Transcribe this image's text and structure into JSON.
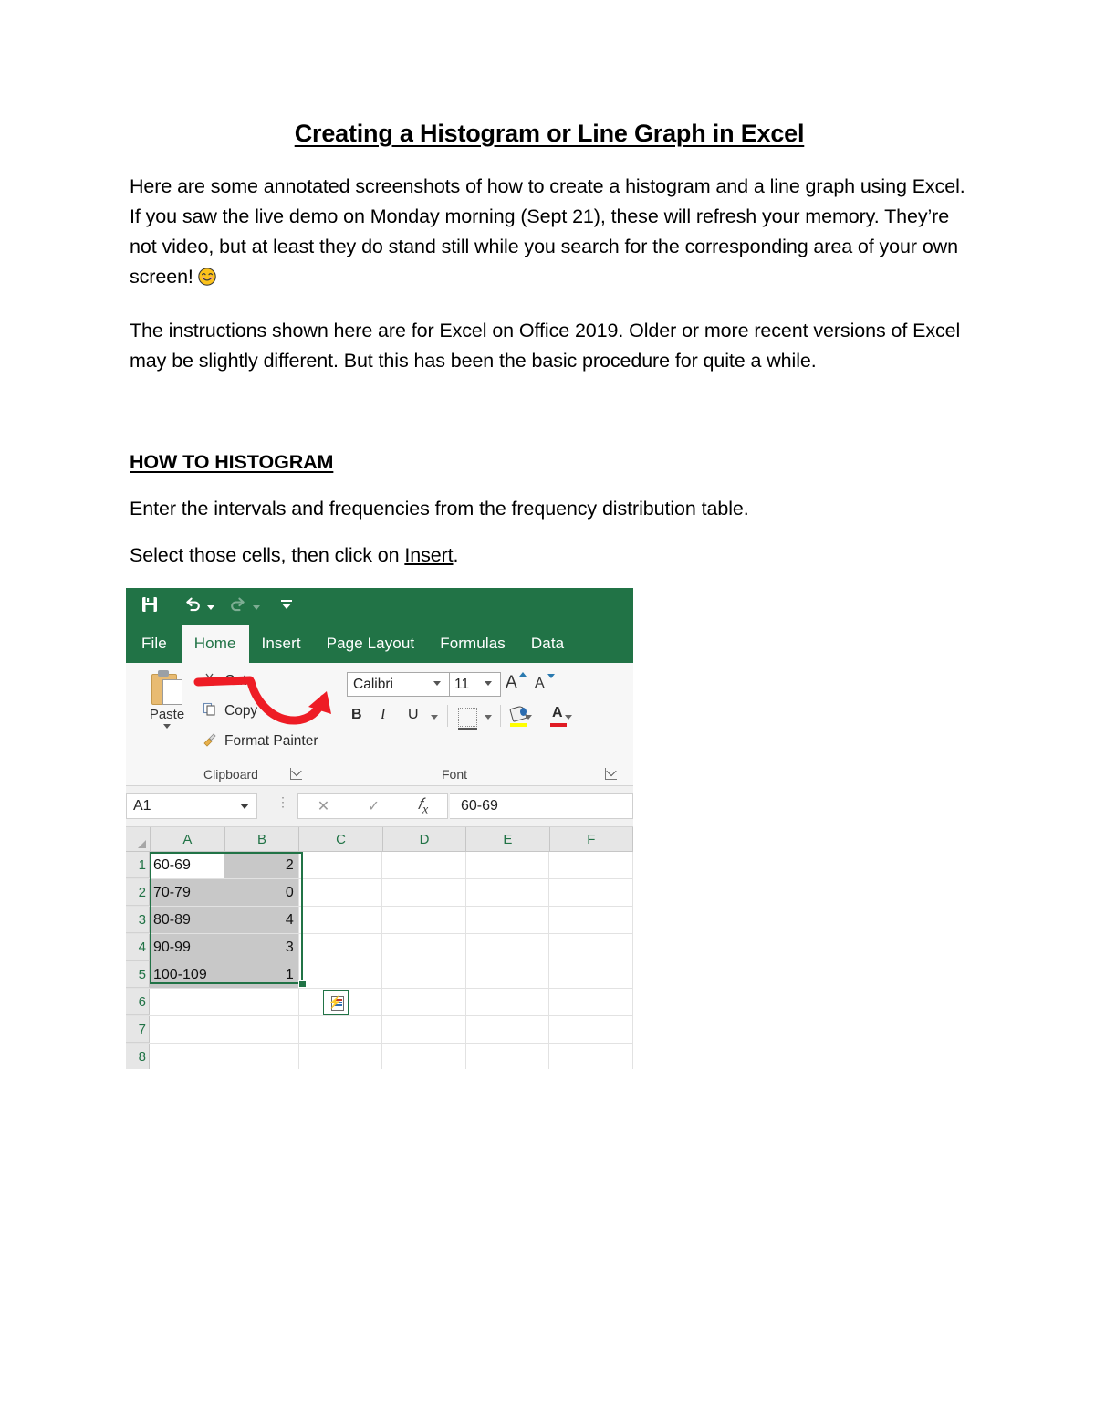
{
  "document": {
    "title": "Creating a Histogram or Line Graph in Excel",
    "paragraph1": "Here are some annotated screenshots of how to create a histogram and a line graph using Excel. If you saw the live demo on Monday morning (Sept 21), these will refresh your memory. They’re not video, but at least they do stand still while you search for the corresponding area of your own screen!",
    "paragraph2": "The instructions shown here are for Excel on Office 2019. Older or more recent versions of Excel may be slightly different. But this has been the basic procedure for quite a while.",
    "section_heading": "HOW TO HISTOGRAM",
    "step1": "Enter the intervals and frequencies from the frequency distribution table.",
    "step2_prefix": "Select those cells, then click on ",
    "step2_link": "Insert",
    "step2_suffix": ".",
    "emoji": "smiling-face"
  },
  "excel": {
    "quick_access": {
      "save_label": "Save",
      "undo_label": "Undo",
      "redo_label": "Redo",
      "customize_label": "Customize Quick Access Toolbar"
    },
    "tabs": [
      {
        "label": "File",
        "active": false
      },
      {
        "label": "Home",
        "active": true
      },
      {
        "label": "Insert",
        "active": false
      },
      {
        "label": "Page Layout",
        "active": false
      },
      {
        "label": "Formulas",
        "active": false
      },
      {
        "label": "Data",
        "active": false
      }
    ],
    "ribbon": {
      "clipboard": {
        "group_label": "Clipboard",
        "paste_label": "Paste",
        "cut_label": "Cut",
        "copy_label": "Copy",
        "format_painter_label": "Format Painter",
        "cut_icon": "scissors-icon",
        "copy_icon": "copy-icon",
        "format_painter_icon": "paintbrush-icon"
      },
      "font": {
        "group_label": "Font",
        "font_name": "Calibri",
        "font_size": "11",
        "grow_font_label": "A",
        "shrink_font_label": "A",
        "bold_label": "B",
        "italic_label": "I",
        "underline_label": "U",
        "borders_icon": "borders-icon",
        "fill_color_icon": "fill-color-icon",
        "font_color_icon": "font-color-icon",
        "fill_color": "#ffff00",
        "font_color": "#e01b24"
      }
    },
    "formula_bar": {
      "name_box": "A1",
      "cancel_icon": "close-icon",
      "enter_icon": "check-icon",
      "function_icon": "fx-icon",
      "value": "60-69"
    },
    "sheet": {
      "columns": [
        "A",
        "B",
        "C",
        "D",
        "E",
        "F"
      ],
      "rows": [
        {
          "header": "1",
          "cells": [
            "60-69",
            "2",
            "",
            "",
            "",
            ""
          ]
        },
        {
          "header": "2",
          "cells": [
            "70-79",
            "0",
            "",
            "",
            "",
            ""
          ]
        },
        {
          "header": "3",
          "cells": [
            "80-89",
            "4",
            "",
            "",
            "",
            ""
          ]
        },
        {
          "header": "4",
          "cells": [
            "90-99",
            "3",
            "",
            "",
            "",
            ""
          ]
        },
        {
          "header": "5",
          "cells": [
            "100-109",
            "1",
            "",
            "",
            "",
            ""
          ]
        },
        {
          "header": "6",
          "cells": [
            "",
            "",
            "",
            "",
            "",
            ""
          ]
        },
        {
          "header": "7",
          "cells": [
            "",
            "",
            "",
            "",
            "",
            ""
          ]
        },
        {
          "header": "8",
          "cells": [
            "",
            "",
            "",
            "",
            "",
            ""
          ]
        }
      ],
      "selection_range": "A1:B5",
      "active_cell": "A1",
      "paste_options_icon": "paste-options-icon"
    },
    "annotation": {
      "type": "red-curved-arrow",
      "color": "#ee1c25",
      "points_to": "Insert"
    }
  }
}
